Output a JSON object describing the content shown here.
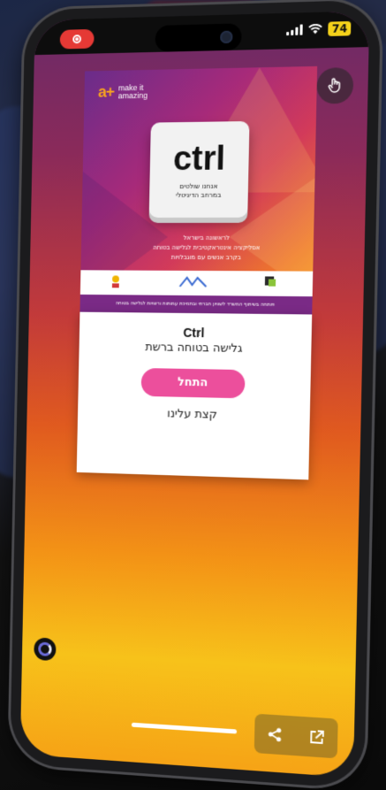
{
  "status": {
    "battery": "74"
  },
  "banner": {
    "brand_mark": "a+",
    "brand_line1": "make it",
    "brand_line2": "amazing",
    "keycap_word": "ctrl",
    "keycap_sub1": "אנחנו שולטים",
    "keycap_sub2": "במרחב הדיגיטלי",
    "headline1": "לראשונה בישראל",
    "headline2": "אפליקציה אינטראקטיבית לגלישה בטוחה",
    "headline3": "בקרב אנשים עם מוגבלויות",
    "footer": "פותחה בשיתוף המשרד לשוויון חברתי ובתמיכת עמותות ורשויות לגלישה בטוחה"
  },
  "info": {
    "app_name": "Ctrl",
    "tagline": "גלישה בטוחה ברשת",
    "start_label": "התחל",
    "about_label": "קצת עלינו"
  },
  "icons": {
    "record": "record-icon",
    "hand": "hand-tap-icon",
    "share": "share-icon",
    "open_external": "open-external-icon",
    "assistant": "assistant-icon"
  },
  "colors": {
    "start_button": "#ec4f9c",
    "battery": "#f4d21b",
    "record": "#e53935"
  }
}
